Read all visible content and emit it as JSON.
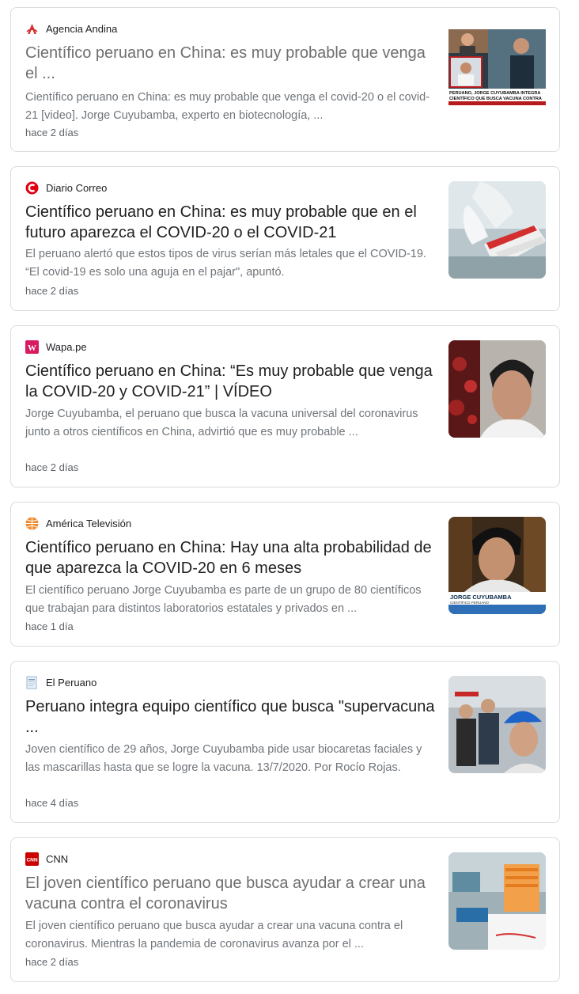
{
  "results": [
    {
      "source": "Agencia Andina",
      "title": "Científico peruano en China: es muy probable que venga el ...",
      "snippet": "Científico peruano en China: es muy probable que venga el covid-20 o el covid-21 [video]. Jorge Cuyubamba, experto en biotecnología, ...",
      "time": "hace 2 días",
      "thumb_caption_1": "PERUANO, JORGE CUYUBAMBA INTEGRA",
      "thumb_caption_2": "CIENTÍFICO QUE BUSCA VACUNA CONTRA"
    },
    {
      "source": "Diario Correo",
      "title": "Científico peruano en China: es muy probable que en el futuro aparezca el COVID-20 o el COVID-21",
      "snippet": "El peruano alertó que estos tipos de virus serían más letales que el COVID-19. “El covid-19 es solo una aguja en el pajar\", apuntó.",
      "time": "hace 2 días"
    },
    {
      "source": "Wapa.pe",
      "title": "Científico peruano en China: “Es muy probable que venga la COVID-20 y COVID-21” | VÍDEO",
      "snippet": "Jorge Cuyubamba, el peruano que busca la vacuna universal del coronavirus junto a otros científicos en China, advirtió que es muy probable ...",
      "time": "hace 2 días"
    },
    {
      "source": "América Televisión",
      "title": "Científico peruano en China: Hay una alta probabilidad de que aparezca la COVID-20 en 6 meses",
      "snippet": "El científico peruano Jorge Cuyubamba es parte de un grupo de 80 científicos que trabajan para distintos laboratorios estatales y privados en ...",
      "time": "hace 1 día",
      "thumb_caption_1": "JORGE CUYUBAMBA",
      "thumb_caption_2": "CIENTÍFICO PERUANO"
    },
    {
      "source": "El Peruano",
      "title": "Peruano integra equipo científico que busca \"supervacuna ...",
      "snippet": "Joven científico de 29 años, Jorge Cuyubamba pide usar biocaretas faciales y las mascarillas hasta que se logre la vacuna. 13/7/2020. Por Rocío Rojas.",
      "time": "hace 4 días"
    },
    {
      "source": "CNN",
      "title": "El joven científico peruano que busca ayudar a crear una vacuna contra el coronavirus",
      "snippet": "El joven científico peruano que busca ayudar a crear una vacuna contra el coronavirus. Mientras la pandemia de coronavirus avanza por el ...",
      "time": "hace 2 días",
      "favicon_text": "CNN"
    }
  ],
  "colors": {
    "title": "#1f1f1f",
    "title_visited": "#6f6f6f",
    "snippet": "#70757a",
    "border": "#dadce0",
    "andina": "#d32f2f",
    "correo": "#e3000f",
    "wapa": "#d81b60",
    "america": "#f08a2c",
    "cnn": "#cc0000"
  },
  "icons": [
    "agencia-andina-favicon",
    "diario-correo-favicon",
    "wapa-favicon",
    "america-tv-favicon",
    "el-peruano-favicon",
    "cnn-favicon"
  ]
}
